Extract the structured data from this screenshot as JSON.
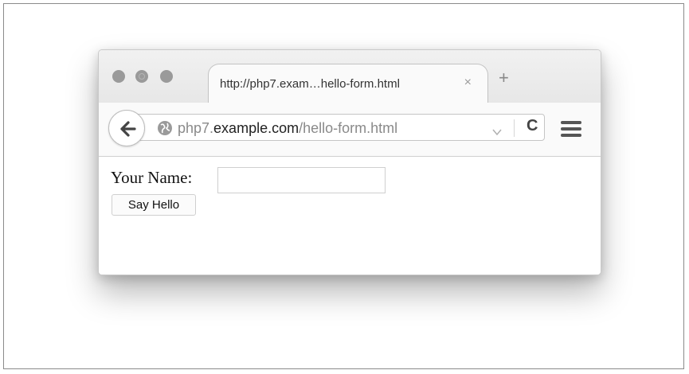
{
  "browser": {
    "tab": {
      "title": "http://php7.exam…hello-form.html",
      "close_glyph": "×"
    },
    "new_tab_glyph": "+",
    "address_bar": {
      "scheme_prefix": "php7.",
      "host": "example.com",
      "path": "/hello-form.html"
    },
    "reload_glyph": "C",
    "icons": [
      "back-arrow-icon",
      "globe-icon",
      "dropdown-icon",
      "reload-icon",
      "hamburger-menu-icon"
    ]
  },
  "page": {
    "form": {
      "label": "Your Name:",
      "input_value": "",
      "submit_label": "Say Hello"
    }
  }
}
